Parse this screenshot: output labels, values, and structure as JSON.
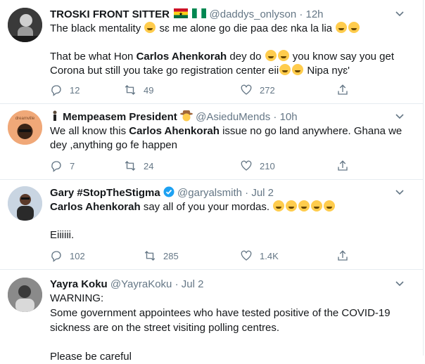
{
  "tweets": [
    {
      "name": "TROSKI FRONT SITTER",
      "handle": "@daddys_onlyson",
      "sep": "·",
      "time": "12h",
      "line1_pre": "The black mentality ",
      "line1_post": " sɛ me alone go die paa deɛ nka la lia ",
      "line2_pre": "That be what Hon ",
      "line2_bold": "Carlos Ahenkorah",
      "line2_post": " dey do ",
      "line2_post2": " you know say you get",
      "line3_pre": "Corona but still you take go registration center eii",
      "line3_post": " Nipa nyɛ'",
      "replies": "12",
      "retweets": "49",
      "likes": "272"
    },
    {
      "name": "Mempeasem President",
      "handle": "@AsieduMends",
      "sep": "·",
      "time": "10h",
      "line1_pre": "We all know this ",
      "line1_bold": "Carlos Ahenkorah",
      "line1_post": " issue no go land anywhere. Ghana we",
      "line2": "dey ,anything go fe happen",
      "avatar_label": "dreamville",
      "replies": "7",
      "retweets": "24",
      "likes": "210"
    },
    {
      "name": "Gary #StopTheStigma",
      "handle": "@garyalsmith",
      "sep": "·",
      "time": "Jul 2",
      "line1_bold": "Carlos Ahenkorah",
      "line1_post": " say all of you your mordas. ",
      "line2": "Eiiiiii.",
      "replies": "102",
      "retweets": "285",
      "likes": "1.4K"
    },
    {
      "name": "Yayra Koku",
      "handle": "@YayraKoku",
      "sep": "·",
      "time": "Jul 2",
      "line1": "WARNING:",
      "line2": "Some government appointees who have tested positive of the COVID-19",
      "line3": "sickness are on the street visiting polling centres.",
      "line4": "Please be careful"
    }
  ],
  "colors": {
    "text": "#14171a",
    "muted": "#657786",
    "border": "#e6ecf0",
    "verified": "#1da1f2"
  },
  "icons": [
    "reply-icon",
    "retweet-icon",
    "like-icon",
    "share-icon",
    "chevron-down-icon",
    "verified-badge-icon"
  ]
}
